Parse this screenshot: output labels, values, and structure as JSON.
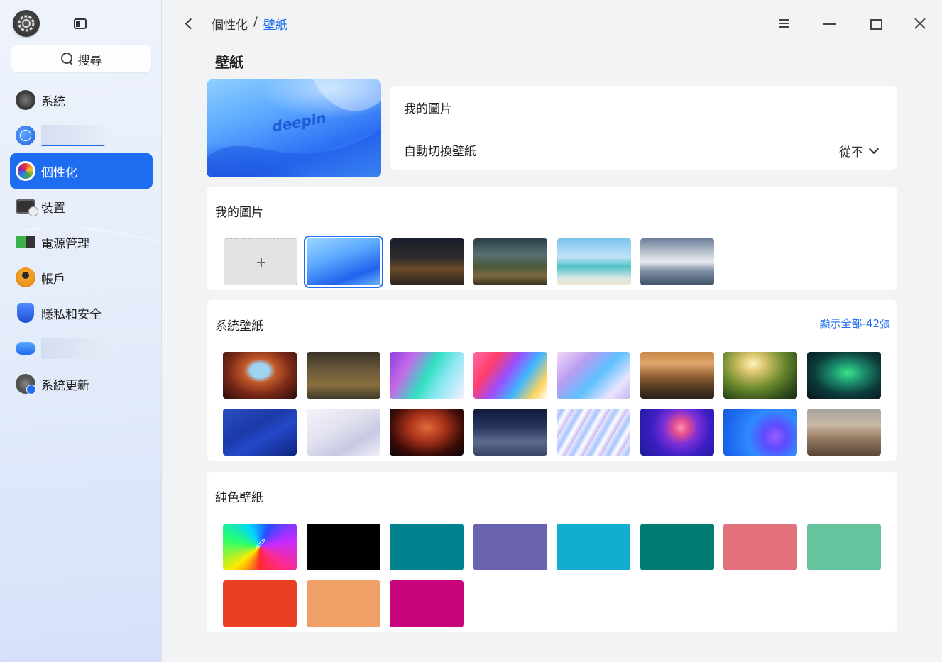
{
  "sidebar": {
    "search_label": "搜尋",
    "items": [
      {
        "label": "系統",
        "icon": "system-icon"
      },
      {
        "label": "",
        "icon": "network-icon"
      },
      {
        "label": "個性化",
        "icon": "personalization-icon",
        "active": true
      },
      {
        "label": "裝置",
        "icon": "device-icon"
      },
      {
        "label": "電源管理",
        "icon": "power-icon"
      },
      {
        "label": "帳戶",
        "icon": "account-icon"
      },
      {
        "label": "隱私和安全",
        "icon": "privacy-icon"
      },
      {
        "label": "",
        "icon": "cloud-icon"
      },
      {
        "label": "系統更新",
        "icon": "update-icon"
      }
    ]
  },
  "header": {
    "breadcrumb_parent": "個性化",
    "breadcrumb_sep": "/",
    "breadcrumb_current": "壁紙"
  },
  "page_title": "壁紙",
  "current_wallpaper": {
    "logo_text": "deepin"
  },
  "settings": {
    "my_pictures_label": "我的圖片",
    "auto_switch_label": "自動切換壁紙",
    "auto_switch_value": "從不"
  },
  "my_pictures": {
    "title": "我的圖片",
    "thumbnails": [
      "add",
      "deepin-blue",
      "night-street",
      "mountain-valley",
      "tropical-beach",
      "cloudy-lake"
    ],
    "selected_index": 1
  },
  "system_wallpapers": {
    "title": "系統壁紙",
    "show_all": "顯示全部-42張",
    "thumbnails": [
      "canyon-arch",
      "autumn-forest",
      "aurora-gradient",
      "rainbow-gradient",
      "pastel-ribbons",
      "mountain-sunset",
      "green-hills",
      "northern-lights",
      "blue-abstract",
      "white-abstract",
      "antelope-canyon",
      "desert-dunes-night",
      "light-streaks",
      "purple-circles",
      "blue-shapes",
      "sand-dunes"
    ]
  },
  "solid_wallpapers": {
    "title": "純色壁紙",
    "colors": [
      "custom",
      "#000000",
      "#01838f",
      "#6a63ae",
      "#13aecf",
      "#007c72",
      "#e3717b",
      "#66c49f",
      "#e94024",
      "#f0a067",
      "#c7047b"
    ]
  }
}
